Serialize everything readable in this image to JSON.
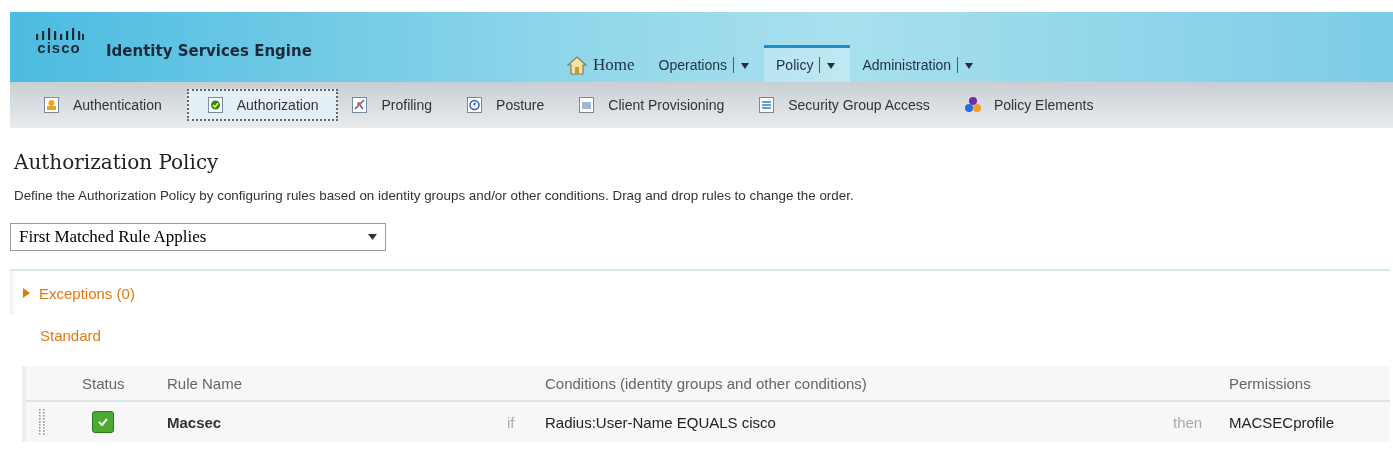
{
  "header": {
    "logo_text": "cisco",
    "product": "Identity Services Engine"
  },
  "top_nav": [
    {
      "label": "Home",
      "kind": "home",
      "selected": false,
      "dropdown": false
    },
    {
      "label": "Operations",
      "kind": "menu",
      "selected": false,
      "dropdown": true
    },
    {
      "label": "Policy",
      "kind": "menu",
      "selected": true,
      "dropdown": true
    },
    {
      "label": "Administration",
      "kind": "menu",
      "selected": false,
      "dropdown": true
    }
  ],
  "sub_nav": [
    {
      "label": "Authentication",
      "kind": "authentication",
      "selected": false
    },
    {
      "label": "Authorization",
      "kind": "authorization",
      "selected": true
    },
    {
      "label": "Profiling",
      "kind": "profiling",
      "selected": false
    },
    {
      "label": "Posture",
      "kind": "posture",
      "selected": false
    },
    {
      "label": "Client Provisioning",
      "kind": "provisioning",
      "selected": false
    },
    {
      "label": "Security Group Access",
      "kind": "security",
      "selected": false
    },
    {
      "label": "Policy Elements",
      "kind": "elements",
      "selected": false
    }
  ],
  "page": {
    "title": "Authorization Policy",
    "description": "Define the Authorization Policy by configuring rules based on identity groups and/or other conditions. Drag and drop rules to change the order.",
    "match_mode": "First Matched Rule Applies"
  },
  "exceptions": {
    "label": "Exceptions (0)",
    "expanded": false
  },
  "standard": {
    "label": "Standard"
  },
  "table": {
    "columns": [
      "Status",
      "Rule Name",
      "Conditions (identity groups and other conditions)",
      "Permissions"
    ],
    "rows": [
      {
        "enabled": true,
        "name": "Macsec",
        "if": "if",
        "condition": "Radius:User-Name EQUALS cisco",
        "then": "then",
        "permission": "MACSECprofile"
      }
    ]
  }
}
